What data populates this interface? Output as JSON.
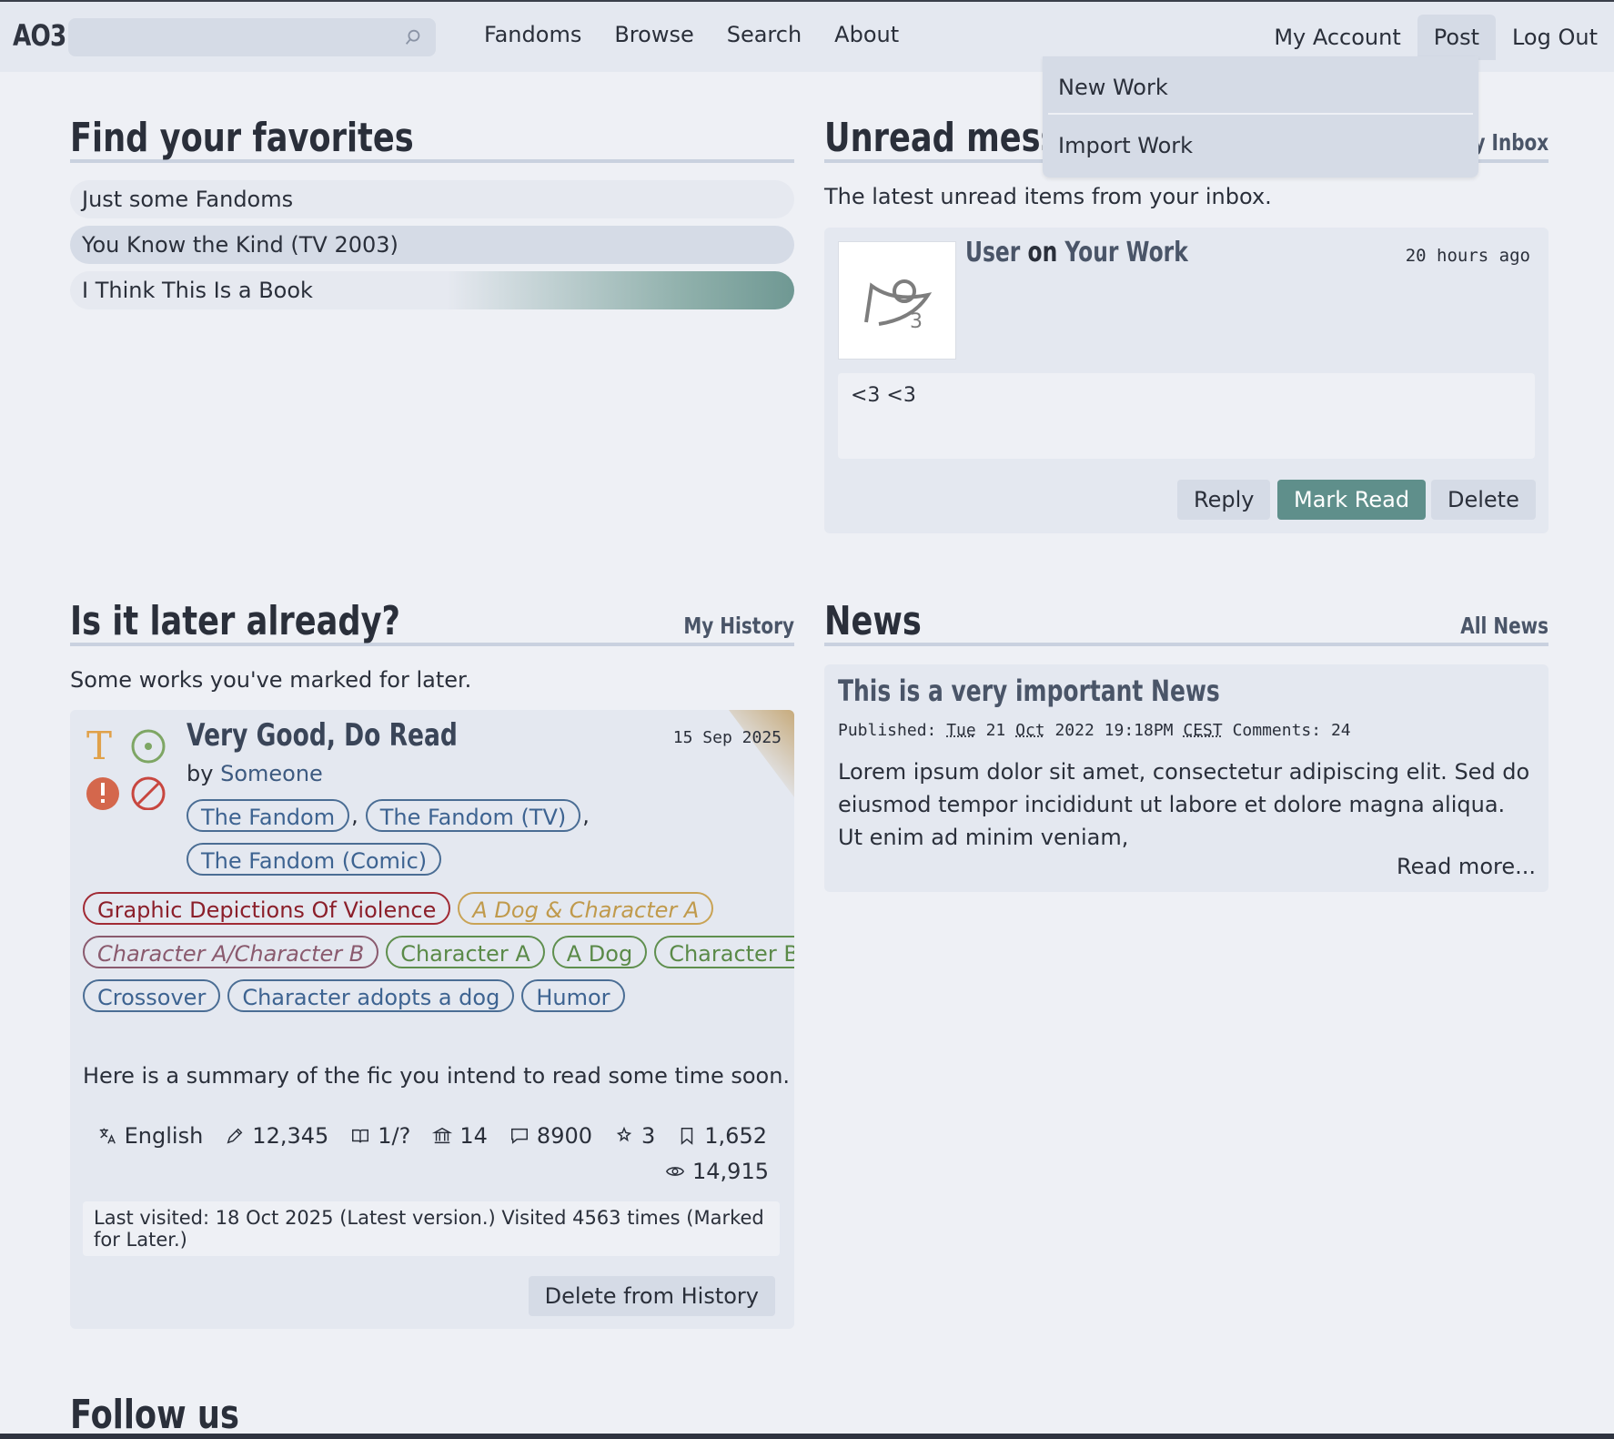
{
  "nav": {
    "logo": "AO3",
    "links": [
      "Fandoms",
      "Browse",
      "Search",
      "About"
    ],
    "right": [
      "My Account",
      "Post",
      "Log Out"
    ],
    "post_menu": [
      "New Work",
      "Import Work"
    ]
  },
  "favorites": {
    "title": "Find your favorites",
    "items": [
      "Just some Fandoms",
      "You Know the Kind (TV 2003)",
      "I Think This Is a Book"
    ]
  },
  "inbox": {
    "title": "Unread messages",
    "link": "My Inbox",
    "desc": "The latest unread items from your inbox.",
    "message": {
      "user": "User",
      "on": "on",
      "work": "Your Work",
      "time": "20 hours ago",
      "body": "<3 <3"
    },
    "buttons": [
      "Reply",
      "Mark Read",
      "Delete"
    ]
  },
  "later": {
    "title": "Is it later already?",
    "link": "My History",
    "desc": "Some works you've marked for later.",
    "work": {
      "title": "Very Good, Do Read",
      "date": "15 Sep 2025",
      "by": "by",
      "author": "Someone",
      "fandoms": [
        "The Fandom",
        "The Fandom (TV)",
        "The Fandom (Comic)"
      ],
      "warning": "Graphic Depictions Of Violence",
      "relationships": [
        "A Dog & Character A",
        "Character A/Character B"
      ],
      "characters": [
        "Character A",
        "A Dog",
        "Character B"
      ],
      "freeforms": [
        "Crossover",
        "Character adopts a dog",
        "Humor"
      ],
      "summary": "Here is a summary of the fic you intend to read some time soon.",
      "stats": {
        "language": "English",
        "words": "12,345",
        "chapters": "1/?",
        "collections": "14",
        "comments": "8900",
        "kudos": "3",
        "bookmarks": "1,652",
        "hits": "14,915"
      },
      "visited": "Last visited: 18 Oct 2025 (Latest version.) Visited 4563 times (Marked for Later.)",
      "delete_label": "Delete from History"
    }
  },
  "news": {
    "title": "News",
    "link": "All News",
    "item": {
      "title": "This is a very important News",
      "published_label": "Published:",
      "day": "Tue",
      "date1": "21",
      "month": "Oct",
      "date2": "2022 19:18PM",
      "tz": "CEST",
      "comments_label": "Comments:",
      "comments": "24",
      "body": "Lorem ipsum dolor sit amet, consectetur adipiscing elit. Sed do eiusmod tempor incididunt ut labore et dolore magna aliqua. Ut enim ad minim veniam,",
      "more": "Read more..."
    }
  },
  "footer": {
    "title": "Follow us"
  },
  "colors": {
    "accent": "#5f8f8b",
    "background": "#eef0f5",
    "card": "#e4e8f0",
    "warning": "#a12a34"
  }
}
